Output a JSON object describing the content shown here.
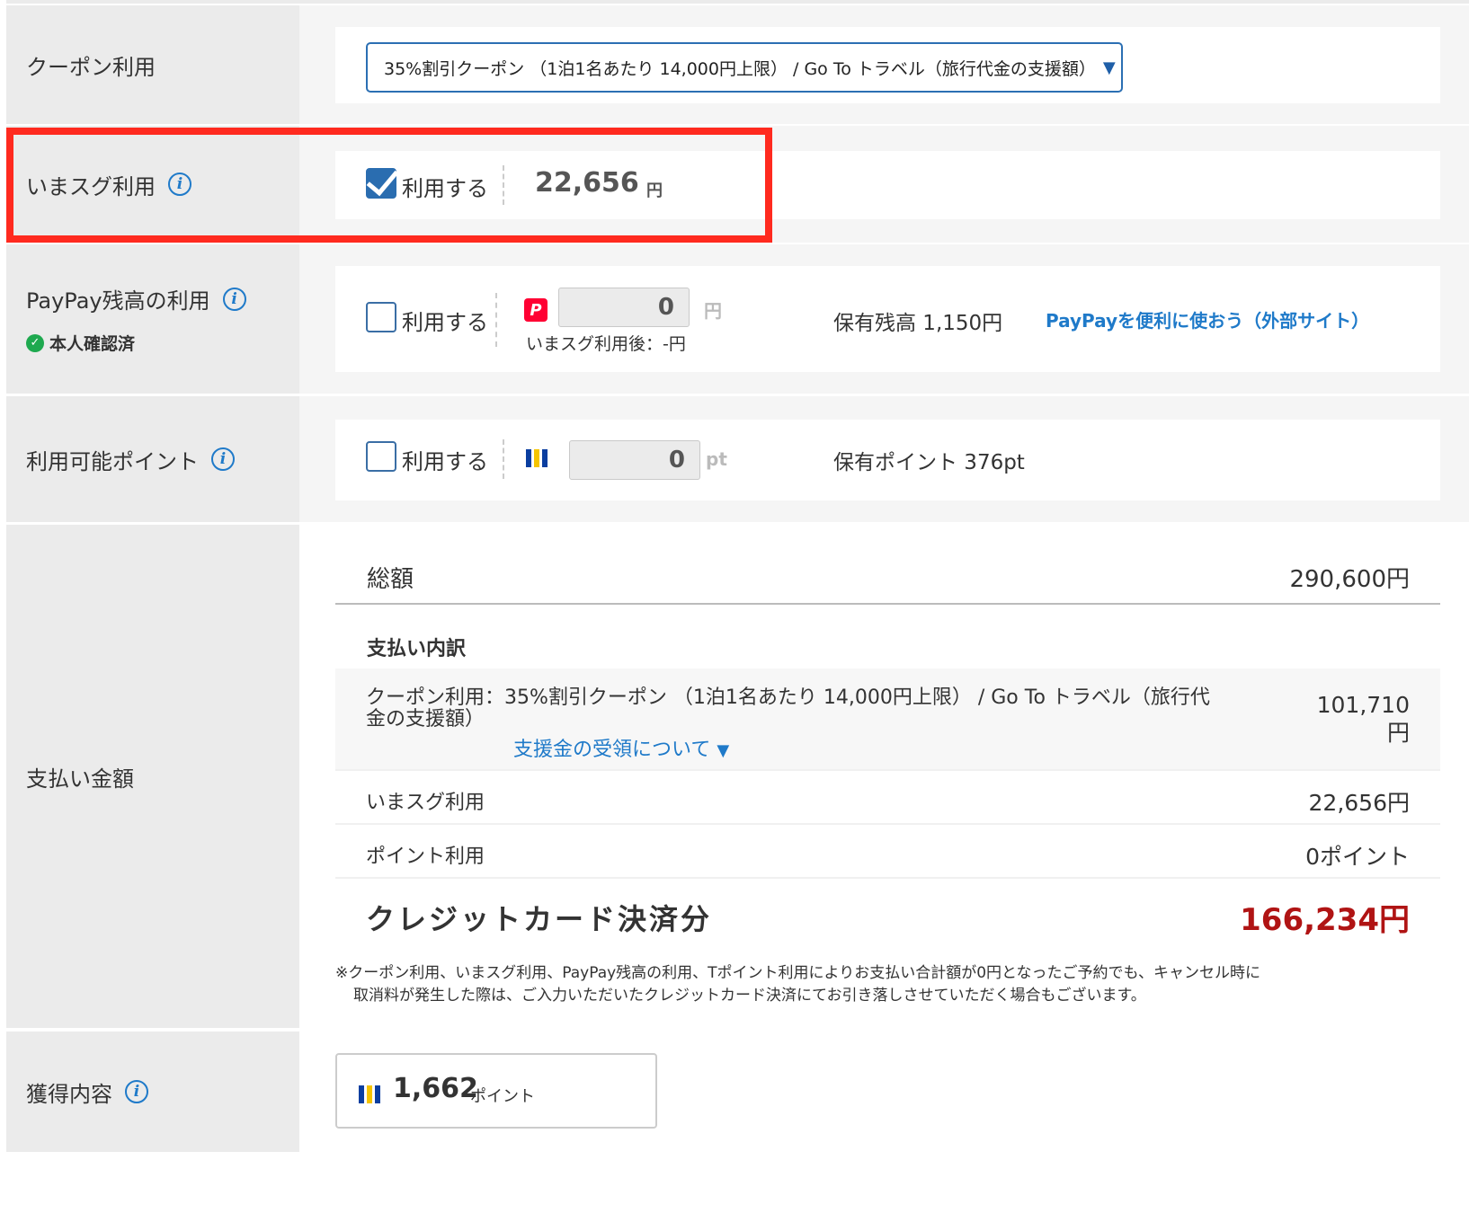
{
  "coupon": {
    "label": "クーポン利用",
    "selected": "35%割引クーポン （1泊1名あたり 14,000円上限） / Go To トラベル（旅行代金の支援額）",
    "caret": "▼"
  },
  "imasugu": {
    "label": "いまスグ利用",
    "checkbox_label": "利用する",
    "checked": true,
    "amount": "22,656",
    "unit": "円"
  },
  "paypay": {
    "label": "PayPay残高の利用",
    "verified": "本人確認済",
    "checkbox_label": "利用する",
    "checked": false,
    "input_value": "0",
    "unit": "円",
    "after_note": "いまスグ利用後：-円",
    "balance": "保有残高 1,150円",
    "link": "PayPayを便利に使おう（外部サイト）"
  },
  "points": {
    "label": "利用可能ポイント",
    "checkbox_label": "利用する",
    "checked": false,
    "input_value": "0",
    "unit": "pt",
    "holding": "保有ポイント 376pt"
  },
  "payment": {
    "label": "支払い金額",
    "total_label": "総額",
    "total_value": "290,600円",
    "breakdown_title": "支払い内訳",
    "coupon_line_1": "クーポン利用：35%割引クーポン （1泊1名あたり 14,000円上限） / Go To トラベル（旅行代",
    "coupon_line_2": "金の支援額）",
    "coupon_value_1": "101,710",
    "coupon_value_2": "円",
    "support_link": "支援金の受領について",
    "support_caret": "▼",
    "imasugu_label": "いまスグ利用",
    "imasugu_value": "22,656円",
    "point_label": "ポイント利用",
    "point_value": "0ポイント",
    "credit_label": "クレジットカード決済分",
    "credit_value": "166,234円",
    "note_1": "※クーポン利用、いまスグ利用、PayPay残高の利用、Tポイント利用によりお支払い合計額が0円となったご予約でも、キャンセル時に",
    "note_2": "取消料が発生した際は、ご入力いただいたクレジットカード決済にてお引き落しさせていただく場合もございます。"
  },
  "earned": {
    "label": "獲得内容",
    "points": "1,662",
    "unit": "ポイント"
  },
  "colors": {
    "accent_blue": "#1f7ac9",
    "highlight_red": "#ff2a1f",
    "price_red": "#b01414",
    "verified_green": "#1ea94f"
  },
  "icons": {
    "info": "info-icon",
    "paypay": "paypay-icon",
    "tpoint": "tpoint-icon",
    "verified": "check-circle-icon"
  }
}
